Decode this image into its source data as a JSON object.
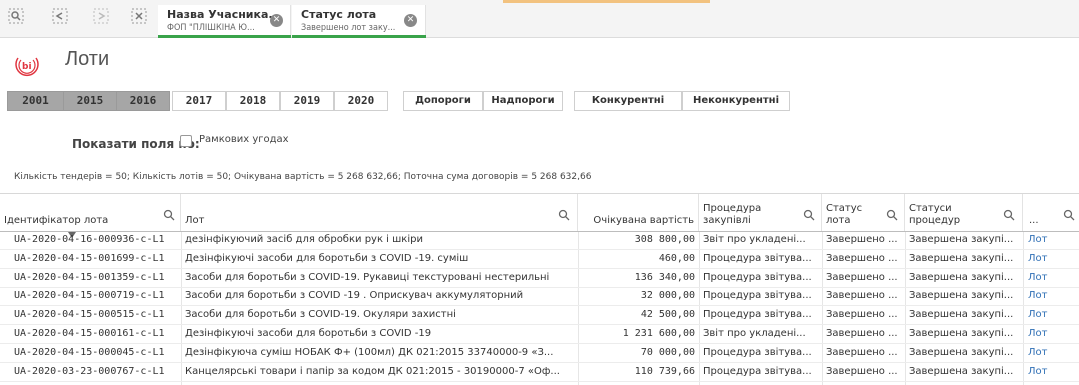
{
  "selections": [
    {
      "title": "Назва Учасника...",
      "value": "ФОП \"ПЛІШКІНА Ю...",
      "close_icon": "close-circle-icon"
    },
    {
      "title": "Статус лота",
      "value": "Завершено лот заку...",
      "close_icon": "close-circle-icon"
    }
  ],
  "toolbar_icons": [
    "zoom-selection-icon",
    "step-back-icon",
    "step-forward-icon",
    "clear-selections-icon"
  ],
  "page": {
    "title": "Лоти",
    "logo": "bi-logo-icon"
  },
  "years": [
    {
      "label": "2001",
      "selected": true
    },
    {
      "label": "2015",
      "selected": true
    },
    {
      "label": "2016",
      "selected": true
    },
    {
      "label": "2017",
      "selected": false
    },
    {
      "label": "2018",
      "selected": false
    },
    {
      "label": "2019",
      "selected": false
    },
    {
      "label": "2020",
      "selected": false
    }
  ],
  "threshold_buttons": [
    "Допороги",
    "Надпороги"
  ],
  "competition_buttons": [
    "Конкурентні",
    "Неконкурентні"
  ],
  "show_fields": {
    "label": "Показати поля по:",
    "checkbox_label": "Рамкових угодах",
    "checked": false
  },
  "summary": "Кількість тендерів = 50; Кількість лотів = 50; Очікувана вартість = 5 268 632,66; Поточна сума договорів = 5 268 632,66",
  "table": {
    "columns": [
      "Ідентифікатор лота",
      "Лот",
      "Очікувана вартість",
      "Процедура закупівлі",
      "Статус лота",
      "Статуси процедур",
      "..."
    ],
    "rows": [
      [
        "UA-2020-04-16-000936-c-L1",
        "дезінфікуючий засіб для обробки рук і шкіри",
        "308 800,00",
        "Звіт про укладені...",
        "Завершено ...",
        "Завершена закупі...",
        "Лот"
      ],
      [
        "UA-2020-04-15-001699-c-L1",
        "Дезінфікуючі засоби для боротьби з COVID -19. суміш",
        "460,00",
        "Процедура звітува...",
        "Завершено ...",
        "Завершена закупі...",
        "Лот"
      ],
      [
        "UA-2020-04-15-001359-c-L1",
        "Засоби для боротьби з COVID-19. Рукавиці текстуровані нестерильні",
        "136 340,00",
        "Процедура звітува...",
        "Завершено ...",
        "Завершена закупі...",
        "Лот"
      ],
      [
        "UA-2020-04-15-000719-c-L1",
        "Засоби для боротьби з COVID -19 . Оприскувач аккумуляторний",
        "32 000,00",
        "Процедура звітува...",
        "Завершено ...",
        "Завершена закупі...",
        "Лот"
      ],
      [
        "UA-2020-04-15-000515-c-L1",
        "Засоби для боротьби з COVID-19. Окуляри захистні",
        "42 500,00",
        "Процедура звітува...",
        "Завершено ...",
        "Завершена закупі...",
        "Лот"
      ],
      [
        "UA-2020-04-15-000161-c-L1",
        "Дезінфікуючі засоби для боротьби з COVID -19",
        "1 231 600,00",
        "Звіт про укладені...",
        "Завершено ...",
        "Завершена закупі...",
        "Лот"
      ],
      [
        "UA-2020-04-15-000045-c-L1",
        "Дезінфікуюча суміш НОБАК Ф+ (100мл) ДК 021:2015 33740000-9 «З...",
        "70 000,00",
        "Процедура звітува...",
        "Завершено ...",
        "Завершена закупі...",
        "Лот"
      ],
      [
        "UA-2020-03-23-000767-c-L1",
        "Канцелярські товари і папір за кодом ДК 021:2015 - 30190000-7 «Оф...",
        "110 739,66",
        "Процедура звітува...",
        "Завершено ...",
        "Завершена закупі...",
        "Лот"
      ]
    ]
  },
  "colors": {
    "selected_year": "#a6a6a6",
    "link": "#2f6fb5",
    "selection_bar": "#39a34a",
    "accent": "#f2c27f",
    "logo": "#e0343f"
  }
}
